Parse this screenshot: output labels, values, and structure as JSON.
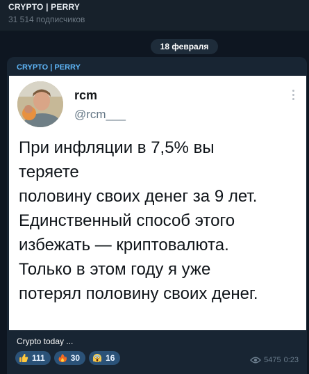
{
  "channel": {
    "title": "CRYPTO | PERRY",
    "subscribers": "31 514 подписчиков"
  },
  "date_separator": "18 февраля",
  "message": {
    "forwarded_from": "CRYPTO | PERRY",
    "tweet": {
      "name": "rcm",
      "handle": "@rcm___",
      "text": "При инфляции в 7,5% вы\nтеряете\nполовину своих денег за 9 лет.\nЕдинственный способ этого\nизбежать — криптовалюта.\nТолько в этом году я уже\nпотерял половину своих денег."
    },
    "caption": "Crypto today ...",
    "reactions": [
      {
        "icon": "thumbs-up-icon",
        "count": "111"
      },
      {
        "icon": "fire-icon",
        "count": "30"
      },
      {
        "icon": "scream-face-icon",
        "count": "16"
      }
    ],
    "views": "5475",
    "time": "0:23"
  },
  "colors": {
    "background": "#0e1621",
    "header": "#17212b",
    "bubble": "#182533",
    "accent": "#5eb5f7",
    "reaction_pill": "#2b5278"
  }
}
